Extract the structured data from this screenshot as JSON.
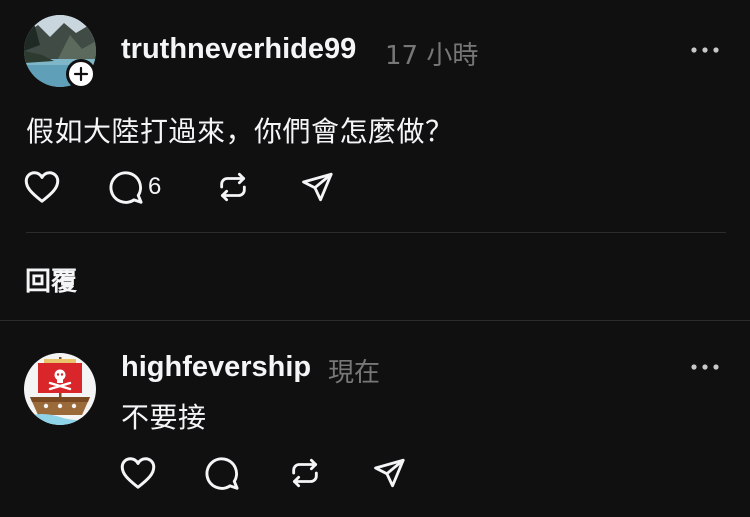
{
  "post": {
    "username": "truthneverhide99",
    "time": "17 小時",
    "text": "假如大陸打過來，你們會怎麼做？",
    "comment_count": "6",
    "avatar_icon": "mountain-lake-avatar",
    "follow_icon": "plus-icon"
  },
  "replies_section": {
    "label": "回覆"
  },
  "reply": {
    "username": "highfevership",
    "time": "現在",
    "text": "不要接",
    "avatar_icon": "pirate-ship-avatar"
  },
  "colors": {
    "background": "#101010",
    "text": "#f3f5f7",
    "muted": "#777777",
    "divider": "#2d2d2d"
  }
}
